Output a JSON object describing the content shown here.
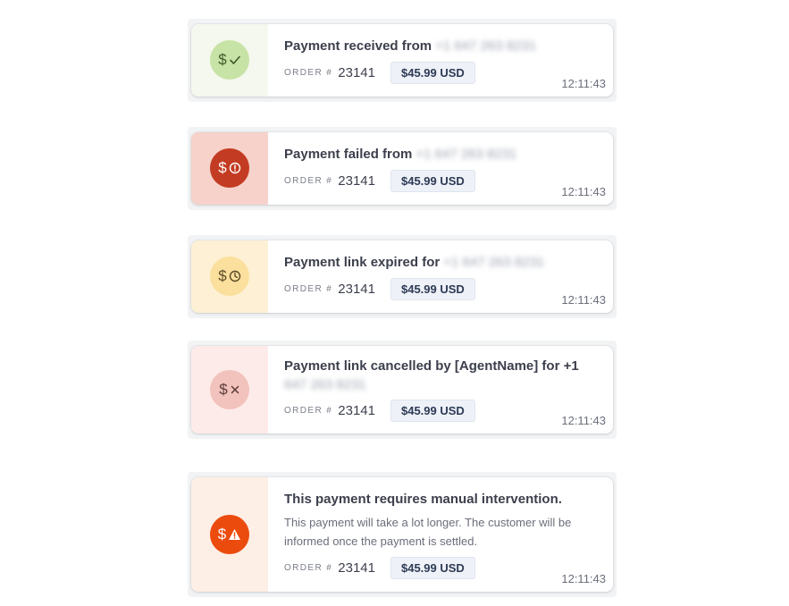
{
  "notifications": [
    {
      "title": "Payment received from",
      "phone": "+1 647 263 8231",
      "order_label": "ORDER #",
      "order_number": "23141",
      "amount": "$45.99 USD",
      "time": "12:11:43",
      "icon": "dollar-check-icon",
      "side_color": "#f4f8ee",
      "badge_color": "#c7e3a5"
    },
    {
      "title": "Payment failed from",
      "phone": "+1 647 263 8231",
      "order_label": "ORDER #",
      "order_number": "23141",
      "amount": "$45.99 USD",
      "time": "12:11:43",
      "icon": "dollar-alert-circle-icon",
      "side_color": "#f6d2cb",
      "badge_color": "#c33b22"
    },
    {
      "title": "Payment link expired for",
      "phone": "+1 647 263 8231",
      "order_label": "ORDER #",
      "order_number": "23141",
      "amount": "$45.99 USD",
      "time": "12:11:43",
      "icon": "dollar-clock-icon",
      "side_color": "#fdf0d4",
      "badge_color": "#fbdf9d"
    },
    {
      "title": "Payment link cancelled by [AgentName] for +1",
      "phone": "647 263 8231",
      "order_label": "ORDER #",
      "order_number": "23141",
      "amount": "$45.99 USD",
      "time": "12:11:43",
      "icon": "dollar-x-icon",
      "side_color": "#fdebe9",
      "badge_color": "#f2c2bc"
    },
    {
      "title": "This payment requires manual intervention.",
      "description": "This payment will take a lot longer. The customer will be informed once the payment is settled.",
      "order_label": "ORDER #",
      "order_number": "23141",
      "amount": "$45.99 USD",
      "time": "12:11:43",
      "icon": "dollar-warning-icon",
      "side_color": "#fdeee6",
      "badge_color": "#ec4b0e"
    }
  ]
}
